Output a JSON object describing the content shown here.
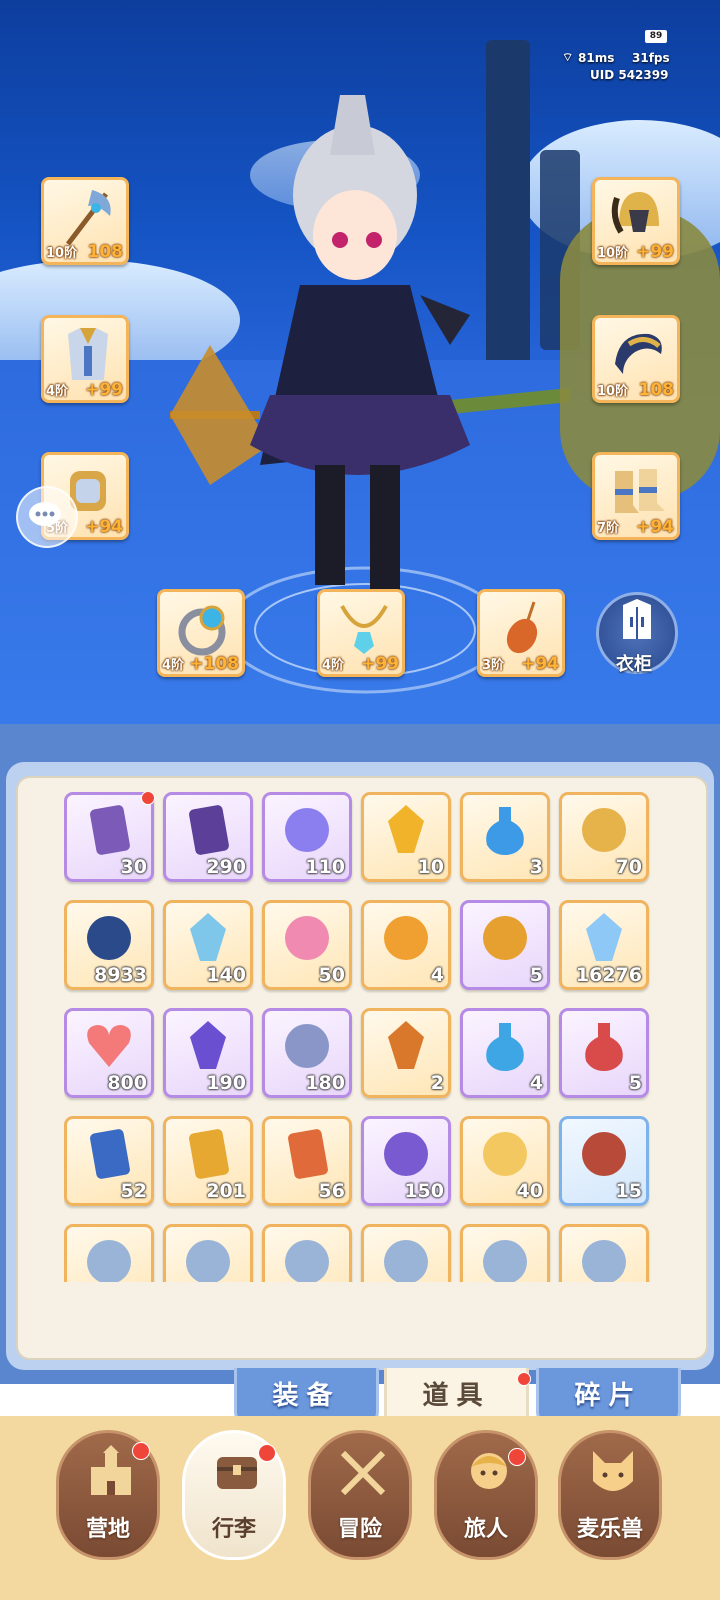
{
  "hud": {
    "ping": "81ms",
    "fps": "31fps",
    "uid": "UID 542399",
    "battery": "89"
  },
  "equipment": [
    {
      "name": "weapon",
      "tier": "10阶",
      "plus": "108"
    },
    {
      "name": "chest",
      "tier": "4阶",
      "plus": "+99"
    },
    {
      "name": "gauntlet",
      "tier": "5阶",
      "plus": "+94"
    },
    {
      "name": "helmet",
      "tier": "10阶",
      "plus": "+99"
    },
    {
      "name": "shoulder",
      "tier": "10阶",
      "plus": "108"
    },
    {
      "name": "boots",
      "tier": "7阶",
      "plus": "+94"
    },
    {
      "name": "ring",
      "tier": "4阶",
      "plus": "+108"
    },
    {
      "name": "necklace",
      "tier": "4阶",
      "plus": "+99"
    },
    {
      "name": "charm",
      "tier": "3阶",
      "plus": "+94"
    }
  ],
  "wardrobe_label": "衣柜",
  "items": [
    {
      "icon": "moon-card-icon",
      "count": "30"
    },
    {
      "icon": "purple-card-icon",
      "count": "290"
    },
    {
      "icon": "paper-plane-icon",
      "count": "110"
    },
    {
      "icon": "gold-crystal-icon",
      "count": "10"
    },
    {
      "icon": "blue-potion-icon",
      "count": "3"
    },
    {
      "icon": "lyre-icon",
      "count": "70"
    },
    {
      "icon": "portal-orb-icon",
      "count": "8933"
    },
    {
      "icon": "ice-crystal-icon",
      "count": "140"
    },
    {
      "icon": "paint-tube-icon",
      "count": "50"
    },
    {
      "icon": "bell-icon",
      "count": "4"
    },
    {
      "icon": "horseshoe-icon",
      "count": "5"
    },
    {
      "icon": "snowflake-icon",
      "count": "16276"
    },
    {
      "icon": "heart-icon",
      "count": "800"
    },
    {
      "icon": "purple-gem-icon",
      "count": "190"
    },
    {
      "icon": "heart-coin-icon",
      "count": "180"
    },
    {
      "icon": "fire-crystal-icon",
      "count": "2"
    },
    {
      "icon": "blue-flask-icon",
      "count": "4"
    },
    {
      "icon": "red-flask-icon",
      "count": "5"
    },
    {
      "icon": "blue-eye-card-icon",
      "count": "52"
    },
    {
      "icon": "gold-eye-card-icon",
      "count": "201"
    },
    {
      "icon": "red-eye-card-icon",
      "count": "56"
    },
    {
      "icon": "cat-mirror-icon",
      "count": "150"
    },
    {
      "icon": "cheese-icon",
      "count": "40"
    },
    {
      "icon": "meat-icon",
      "count": "15"
    },
    {
      "icon": "partial-item-icon",
      "count": ""
    },
    {
      "icon": "partial-item-icon",
      "count": ""
    },
    {
      "icon": "partial-item-icon",
      "count": ""
    },
    {
      "icon": "partial-item-icon",
      "count": ""
    },
    {
      "icon": "partial-item-icon",
      "count": ""
    },
    {
      "icon": "partial-item-icon",
      "count": ""
    }
  ],
  "tabs": [
    {
      "label": "装备"
    },
    {
      "label": "道具"
    },
    {
      "label": "碎片"
    }
  ],
  "nav": [
    {
      "label": "营地"
    },
    {
      "label": "行李"
    },
    {
      "label": "冒险"
    },
    {
      "label": "旅人"
    },
    {
      "label": "麦乐兽"
    }
  ],
  "colors": {
    "accent": "#f0b35e",
    "badge": "#f0463a",
    "panel": "#f6f1e4",
    "tab_blue": "#6b97dd"
  }
}
